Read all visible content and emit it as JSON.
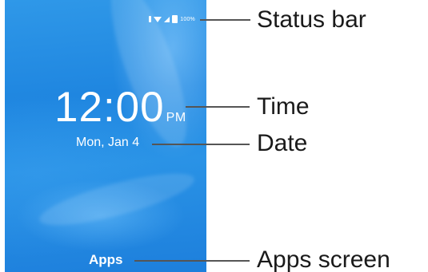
{
  "device_screen": {
    "status_bar": {
      "battery_percent": "100%",
      "icons": [
        "bluetooth-icon",
        "wifi-icon",
        "signal-icon",
        "battery-icon"
      ]
    },
    "time": "12:00",
    "time_period": "PM",
    "date": "Mon, Jan 4",
    "apps_label": "Apps",
    "background_color": "#2a8ee4"
  },
  "callouts": {
    "status_bar": "Status bar",
    "time": "Time",
    "date": "Date",
    "apps_screen": "Apps screen"
  },
  "colors": {
    "leader_line": "#555555",
    "callout_text": "#1a1a1a"
  }
}
